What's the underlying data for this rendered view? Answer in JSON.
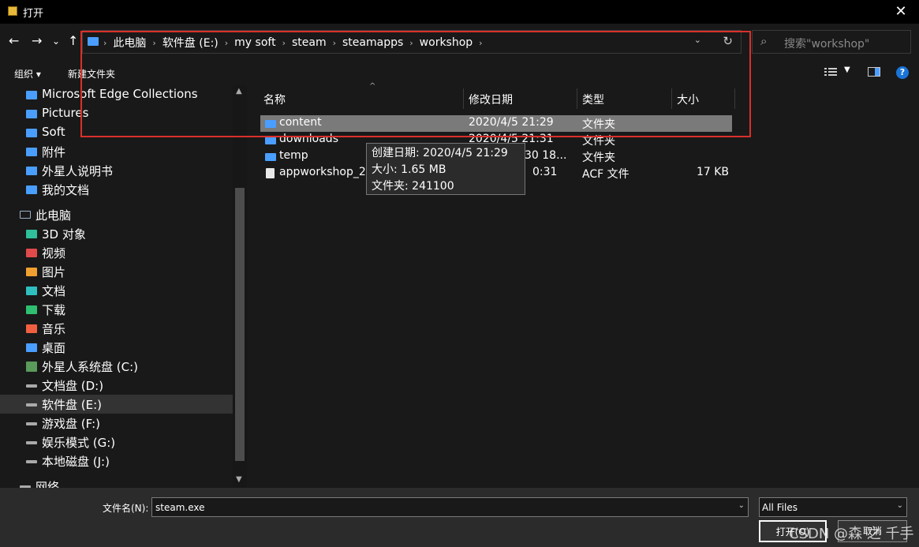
{
  "window": {
    "title": "打开",
    "close": "✕"
  },
  "nav": {
    "back": "←",
    "forward": "→",
    "recent": "⌄",
    "up": "↑",
    "refresh": "↻",
    "dropdown": "⌄"
  },
  "breadcrumb": [
    "此电脑",
    "软件盘 (E:)",
    "my soft",
    "steam",
    "steamapps",
    "workshop"
  ],
  "search": {
    "placeholder": "搜索\"workshop\""
  },
  "commands": {
    "organize": "组织 ▾",
    "new_folder": "新建文件夹",
    "help": "?"
  },
  "sidebar": {
    "items": [
      {
        "label": "Microsoft Edge Collections",
        "color": "#4a9eff"
      },
      {
        "label": "Pictures",
        "color": "#4a9eff"
      },
      {
        "label": "Soft",
        "color": "#4a9eff"
      },
      {
        "label": "附件",
        "color": "#4a9eff"
      },
      {
        "label": "外星人说明书",
        "color": "#4a9eff"
      },
      {
        "label": "我的文档",
        "color": "#4a9eff"
      },
      {
        "label": "此电脑",
        "color": "#9ab0c8"
      },
      {
        "label": "3D 对象",
        "color": "#2fbf9a"
      },
      {
        "label": "视频",
        "color": "#e04a4a"
      },
      {
        "label": "图片",
        "color": "#f0a030"
      },
      {
        "label": "文档",
        "color": "#2fbfbf"
      },
      {
        "label": "下载",
        "color": "#2fbf70"
      },
      {
        "label": "音乐",
        "color": "#f06040"
      },
      {
        "label": "桌面",
        "color": "#4a9eff"
      },
      {
        "label": "外星人系统盘 (C:)",
        "color": "#5a9a5a"
      },
      {
        "label": "文档盘 (D:)",
        "color": "#aaaaaa"
      },
      {
        "label": "软件盘 (E:)",
        "color": "#aaaaaa"
      },
      {
        "label": "游戏盘 (F:)",
        "color": "#aaaaaa"
      },
      {
        "label": "娱乐模式 (G:)",
        "color": "#aaaaaa"
      },
      {
        "label": "本地磁盘 (J:)",
        "color": "#aaaaaa"
      },
      {
        "label": "网络",
        "color": "#aaaaaa"
      }
    ]
  },
  "columns": {
    "name": "名称",
    "date": "修改日期",
    "type": "类型",
    "size": "大小"
  },
  "files": [
    {
      "name": "content",
      "date": "2020/4/5  21:29",
      "type": "文件夹",
      "size": ""
    },
    {
      "name": "downloads",
      "date": "2020/4/5  21:31",
      "type": "文件夹",
      "size": ""
    },
    {
      "name": "temp",
      "date": "30  18...",
      "type": "文件夹",
      "size": ""
    },
    {
      "name": "appworkshop_2",
      "date": "0:31",
      "type": "ACF 文件",
      "size": "17 KB"
    }
  ],
  "tooltip": {
    "created": "创建日期: 2020/4/5  21:29",
    "size": "大小: 1.65 MB",
    "folder": "文件夹: 241100"
  },
  "footer": {
    "filename_label": "文件名(N):",
    "filename_value": "steam.exe",
    "filter": "All Files",
    "open": "打开(O)",
    "cancel": "取消",
    "watermark": "CSDN @森 之 千手"
  }
}
